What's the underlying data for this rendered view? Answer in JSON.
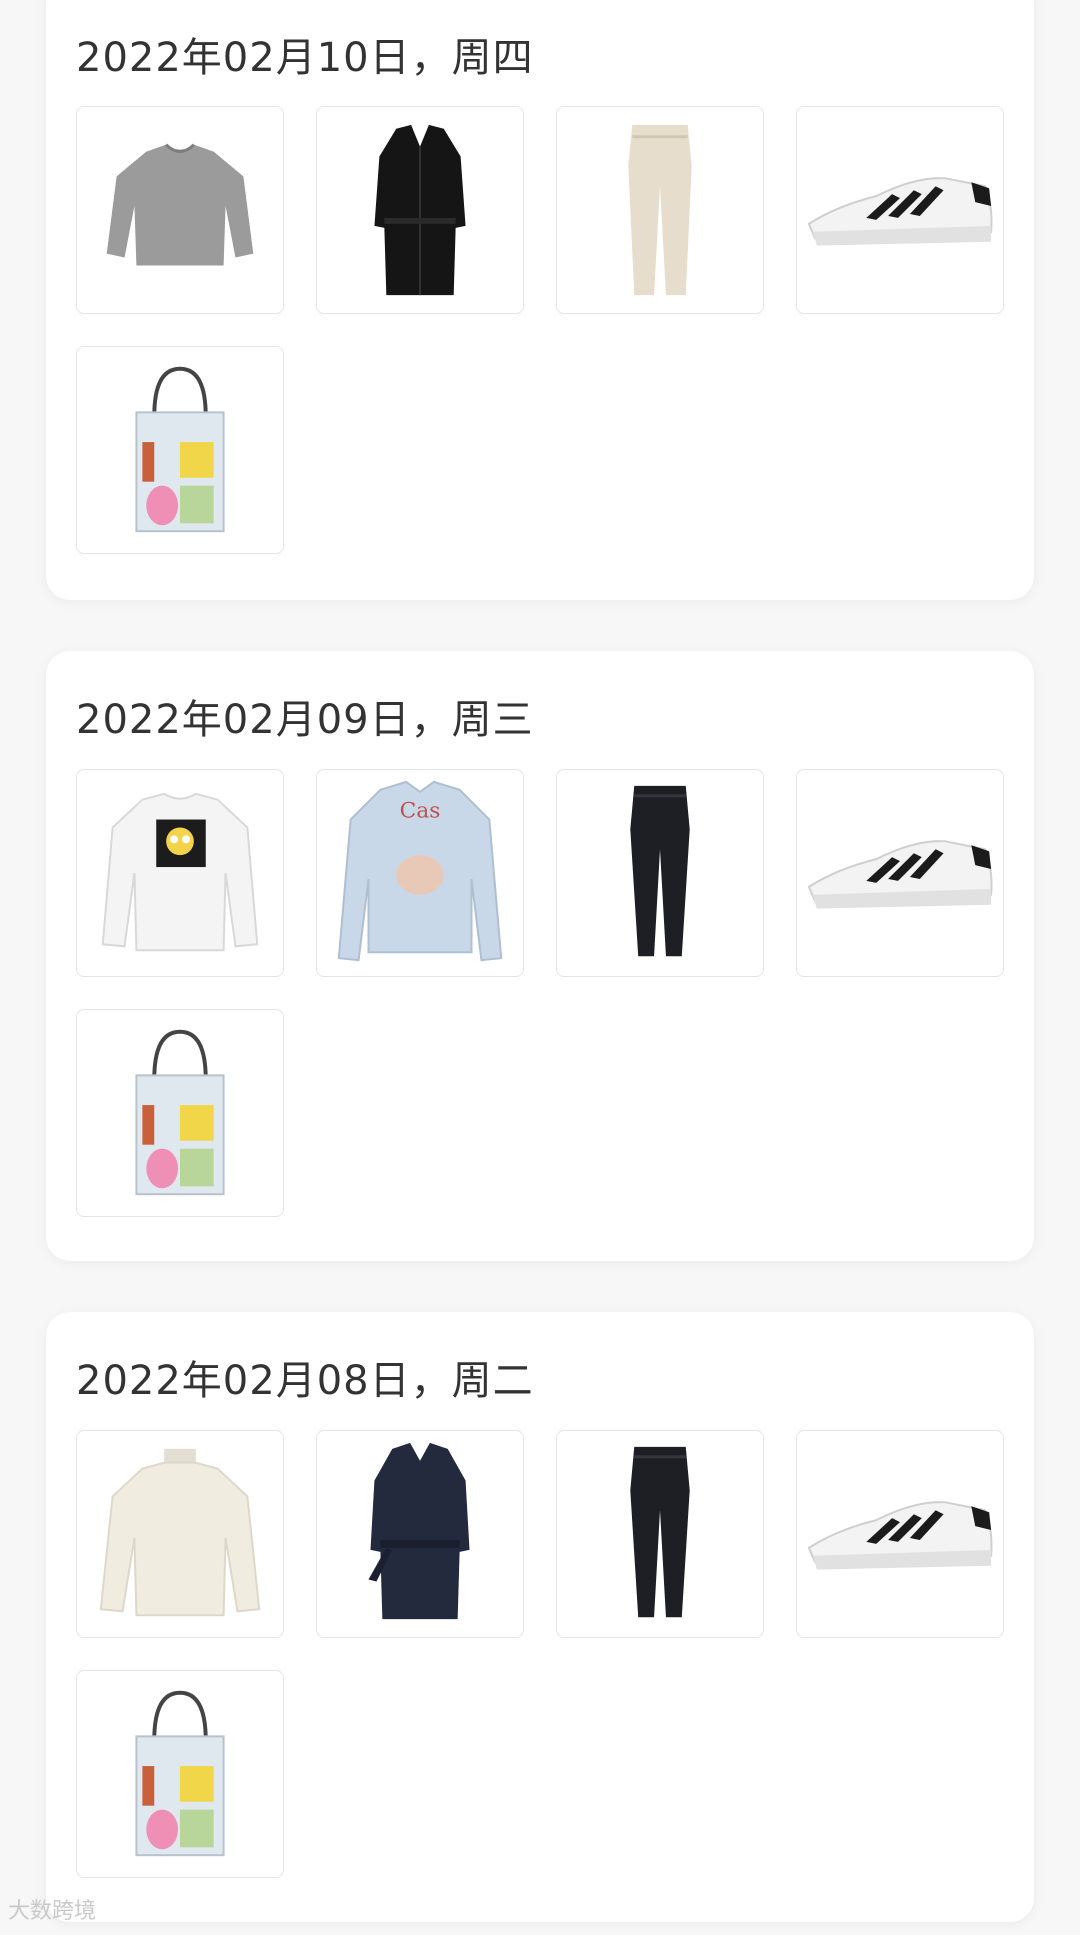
{
  "days": [
    {
      "date_label": "2022年02月10日，周四",
      "items": [
        {
          "icon": "gray-sweater-icon",
          "color": "#9b9b9b"
        },
        {
          "icon": "black-trench-coat-icon",
          "color": "#151515"
        },
        {
          "icon": "cream-trousers-icon",
          "color": "#e7ddcc"
        },
        {
          "icon": "white-sneaker-icon",
          "color": "#f3f3f3"
        },
        {
          "icon": "clear-tote-bag-icon",
          "color": "#dfe7ef"
        }
      ]
    },
    {
      "date_label": "2022年02月09日，周三",
      "items": [
        {
          "icon": "white-graphic-sweatshirt-icon",
          "color": "#f4f4f4"
        },
        {
          "icon": "light-denim-jacket-icon",
          "color": "#c9d8e8"
        },
        {
          "icon": "black-jeans-icon",
          "color": "#1d1f24"
        },
        {
          "icon": "white-sneaker-icon",
          "color": "#f3f3f3"
        },
        {
          "icon": "clear-tote-bag-icon",
          "color": "#dfe7ef"
        }
      ]
    },
    {
      "date_label": "2022年02月08日，周二",
      "items": [
        {
          "icon": "cream-turtleneck-sweater-icon",
          "color": "#f0ece0"
        },
        {
          "icon": "navy-wrap-coat-icon",
          "color": "#232a3d"
        },
        {
          "icon": "black-jeans-icon",
          "color": "#1d1f24"
        },
        {
          "icon": "white-sneaker-icon",
          "color": "#f3f3f3"
        },
        {
          "icon": "clear-tote-bag-icon",
          "color": "#dfe7ef"
        }
      ]
    }
  ],
  "watermark": "大数跨境"
}
